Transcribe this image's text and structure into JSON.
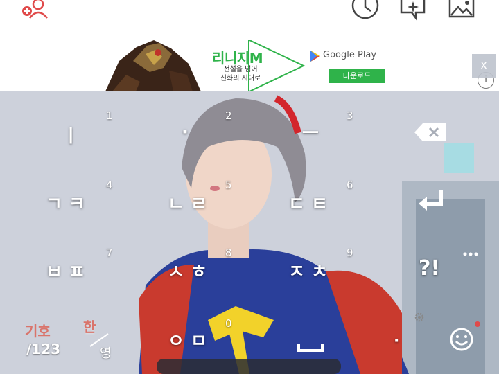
{
  "toolbar": {
    "icons": [
      "add-person-icon",
      "clock-icon",
      "sparkle-chat-icon",
      "image-icon"
    ]
  },
  "ad": {
    "title": "리니지M",
    "subtitle_line1": "전설을 넘어",
    "subtitle_line2": "신화의 시대로",
    "store_label": "Google Play",
    "download_label": "다운로드",
    "info_label": "i",
    "close_label": "X"
  },
  "keyboard": {
    "keys": {
      "k1": "ㅣ",
      "k2": "·",
      "k3": "ㅡ",
      "k4": "ㄱ ㅋ",
      "k5": "ㄴ ㄹ",
      "k6": "ㄷ ㅌ",
      "k7": "ㅂ ㅍ",
      "k8": "ㅅ ㅎ",
      "k9": "ㅈ ㅊ",
      "k0": "ㅇ ㅁ",
      "qmark": "?!",
      "dot": "·"
    },
    "numbers": {
      "n1": "1",
      "n2": "2",
      "n3": "3",
      "n4": "4",
      "n5": "5",
      "n6": "6",
      "n7": "7",
      "n8": "8",
      "n9": "9",
      "n0": "0"
    },
    "symbol_label": "기호",
    "numeric_label": "/123",
    "lang_current": "한",
    "lang_other": "영",
    "icons": [
      "backspace-icon",
      "enter-icon",
      "space-icon",
      "emoji-icon",
      "settings-gear-icon",
      "more-dots-icon"
    ]
  },
  "colors": {
    "accent_green": "#2fb34a",
    "accent_red": "#e04a4a",
    "key_text": "#ffffff"
  }
}
